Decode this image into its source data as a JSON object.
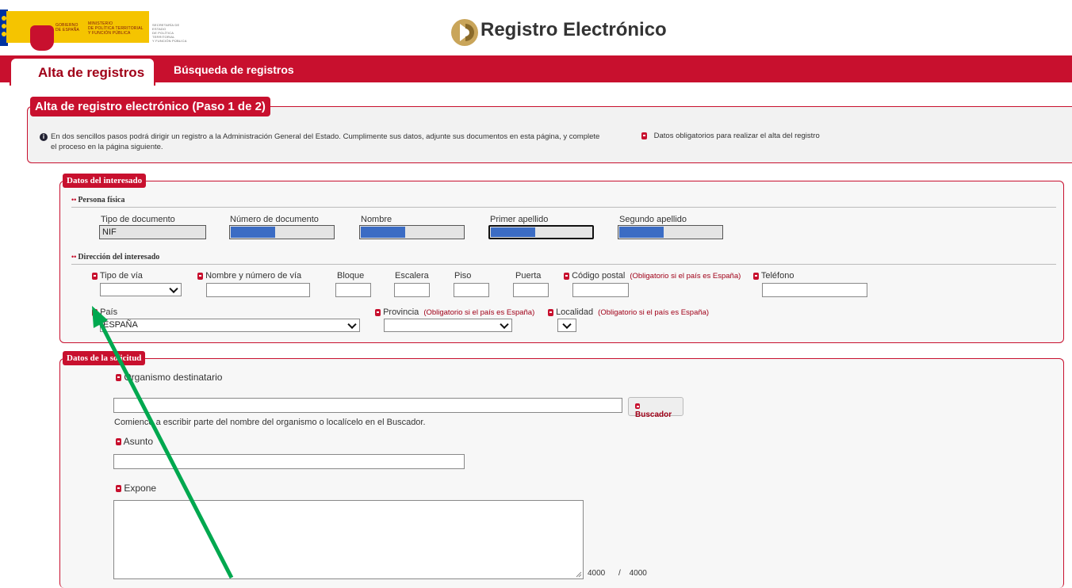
{
  "header": {
    "gov_lines": [
      "GOBIERNO",
      "DE ESPAÑA"
    ],
    "ministry_lines": [
      "MINISTERIO",
      "DE POLÍTICA TERRITORIAL",
      "Y FUNCIÓN PÚBLICA"
    ],
    "secretary_lines": [
      "SECRETARÍA DE ESTADO",
      "DE POLÍTICA TERRITORIAL",
      "Y FUNCIÓN PÚBLICA"
    ],
    "app_title": "Registro Electrónico"
  },
  "nav": {
    "tabs": [
      {
        "label": "Alta de registros",
        "active": true
      },
      {
        "label": "Búsqueda de registros",
        "active": false
      }
    ]
  },
  "section": {
    "title": "Alta de registro electrónico (Paso 1 de 2)",
    "info_line1": "En dos sencillos pasos podrá dirigir un registro a la Administración General del Estado. Cumplimente sus datos, adjunte sus documentos en esta página, y complete",
    "info_line2": "el proceso en la página siguiente.",
    "required_legend": "Datos obligatorios para realizar el alta del registro"
  },
  "interesado": {
    "title": "Datos del interesado",
    "persona_label": "Persona física",
    "fields": {
      "tipo_documento": {
        "label": "Tipo de documento",
        "value": "NIF"
      },
      "numero_documento": {
        "label": "Número de documento"
      },
      "nombre": {
        "label": "Nombre"
      },
      "primer_apellido": {
        "label": "Primer apellido"
      },
      "segundo_apellido": {
        "label": "Segundo apellido"
      }
    },
    "direccion_label": "Dirección del interesado",
    "direccion": {
      "tipo_via": "Tipo de vía",
      "nombre_via": "Nombre y número de vía",
      "bloque": "Bloque",
      "escalera": "Escalera",
      "piso": "Piso",
      "puerta": "Puerta",
      "codigo_postal": "Código postal",
      "codigo_postal_hint": "(Obligatorio si el país es España)",
      "telefono": "Teléfono",
      "pais": "País",
      "pais_value": "ESPAÑA",
      "provincia": "Provincia",
      "provincia_hint": "(Obligatorio si el país es España)",
      "localidad": "Localidad",
      "localidad_hint": "(Obligatorio si el país es España)"
    }
  },
  "solicitud": {
    "title": "Datos de la solicitud",
    "organismo_label": "Organismo destinatario",
    "buscador_button": "Buscador",
    "organismo_help": "Comience a escribir parte del nombre del organismo o localícelo en el Buscador.",
    "asunto_label": "Asunto",
    "expone_label": "Expone",
    "counter_remaining": "4000",
    "counter_sep": "/",
    "counter_total": "4000"
  },
  "colors": {
    "brand_red": "#c8102e",
    "annotation_arrow": "#00a84f"
  }
}
